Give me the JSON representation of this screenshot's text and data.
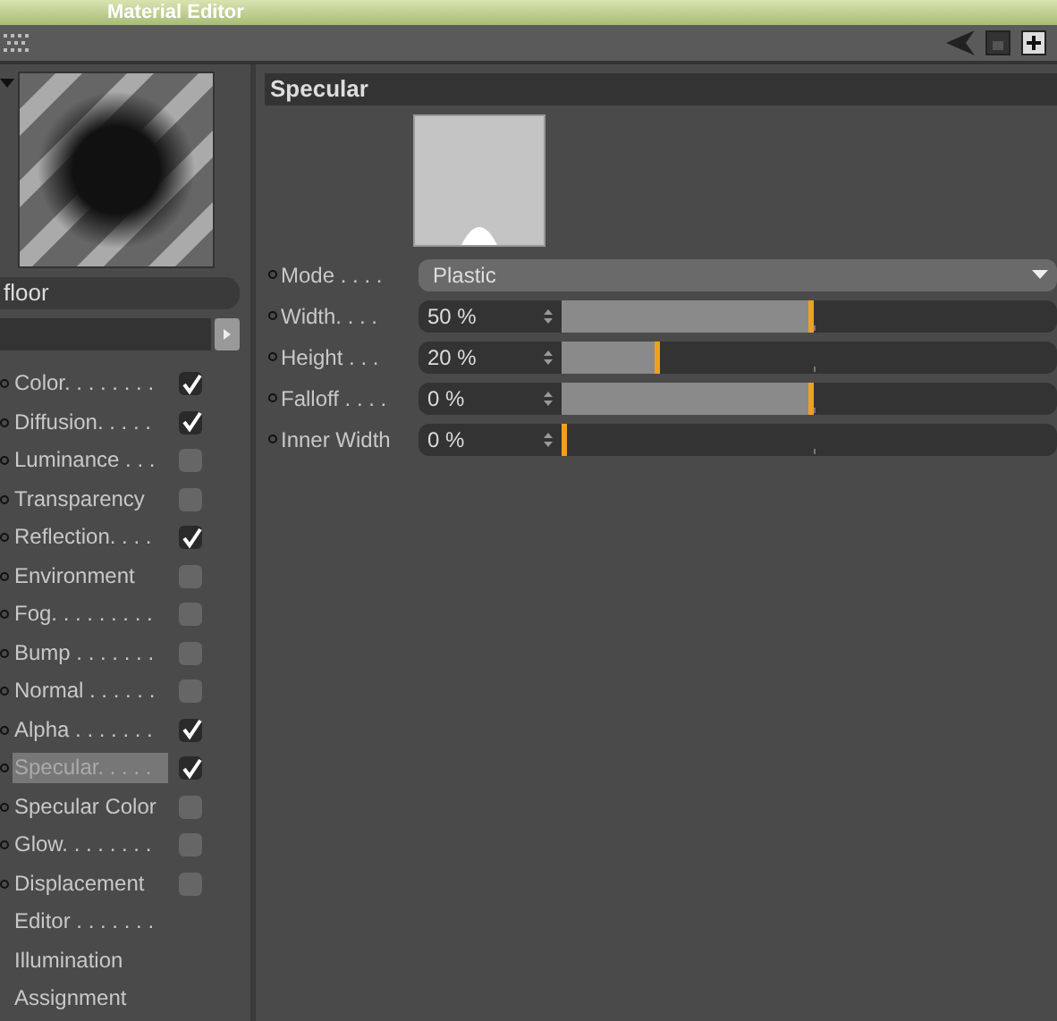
{
  "window": {
    "title": "Material Editor"
  },
  "material": {
    "name": "floor"
  },
  "channels": [
    {
      "kind": "channel",
      "label": "Color. . . . . . . .",
      "checked": true,
      "selected": false
    },
    {
      "kind": "channel",
      "label": "Diffusion. . . . .",
      "checked": true,
      "selected": false
    },
    {
      "kind": "channel",
      "label": "Luminance . . .",
      "checked": false,
      "selected": false
    },
    {
      "kind": "channel",
      "label": "Transparency",
      "checked": false,
      "selected": false
    },
    {
      "kind": "channel",
      "label": "Reflection. . . .",
      "checked": true,
      "selected": false
    },
    {
      "kind": "channel",
      "label": "Environment",
      "checked": false,
      "selected": false
    },
    {
      "kind": "channel",
      "label": "Fog. . . . . . . . .",
      "checked": false,
      "selected": false
    },
    {
      "kind": "channel",
      "label": "Bump . . . . . . .",
      "checked": false,
      "selected": false
    },
    {
      "kind": "channel",
      "label": "Normal . . . . . .",
      "checked": false,
      "selected": false
    },
    {
      "kind": "channel",
      "label": "Alpha . . . . . . .",
      "checked": true,
      "selected": false
    },
    {
      "kind": "channel",
      "label": "Specular. . . . .",
      "checked": true,
      "selected": true
    },
    {
      "kind": "channel",
      "label": "Specular Color",
      "checked": false,
      "selected": false
    },
    {
      "kind": "channel",
      "label": "Glow. . . . . . . .",
      "checked": false,
      "selected": false
    },
    {
      "kind": "channel",
      "label": "Displacement",
      "checked": false,
      "selected": false
    },
    {
      "kind": "page",
      "label": "Editor . . . . . . .",
      "selected": false
    },
    {
      "kind": "page",
      "label": "Illumination",
      "selected": false
    },
    {
      "kind": "page",
      "label": "Assignment",
      "selected": false
    }
  ],
  "section": {
    "title": "Specular"
  },
  "mode": {
    "label": "Mode . . . .",
    "value": "Plastic"
  },
  "parameters": [
    {
      "label": "Width. . . .",
      "value": "50 %",
      "level": 0.51
    },
    {
      "label": "Height . . .",
      "value": "20 %",
      "level": 0.2
    },
    {
      "label": "Falloff . . . .",
      "value": "0 %",
      "level": 0.51
    },
    {
      "label": "Inner Width",
      "value": "0 %",
      "level": 0
    }
  ]
}
